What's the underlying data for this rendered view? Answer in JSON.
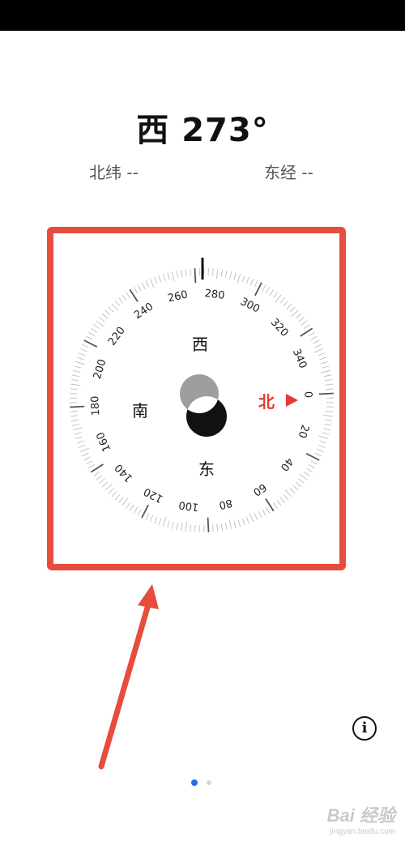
{
  "app": {
    "heading": "西 273°",
    "latitude": "北纬 --",
    "longitude": "东经 --"
  },
  "compass": {
    "heading_degrees": 273,
    "degree_labels": [
      "0",
      "20",
      "40",
      "60",
      "80",
      "100",
      "120",
      "140",
      "160",
      "180",
      "200",
      "220",
      "240",
      "260",
      "280",
      "300",
      "320",
      "340"
    ],
    "cardinals": {
      "north": "北",
      "east": "东",
      "south": "南",
      "west": "西"
    },
    "north_color": "#e53935"
  },
  "annotation": {
    "box_color": "#e74c3c",
    "arrow_color": "#e74c3c"
  },
  "info_button": {
    "icon": "info-icon",
    "glyph": "i"
  },
  "pagination": {
    "pages": 2,
    "current": 1,
    "active_color": "#1a73e8"
  },
  "watermark": {
    "brand": "Bai 经验",
    "url": "jingyan.baidu.com"
  }
}
